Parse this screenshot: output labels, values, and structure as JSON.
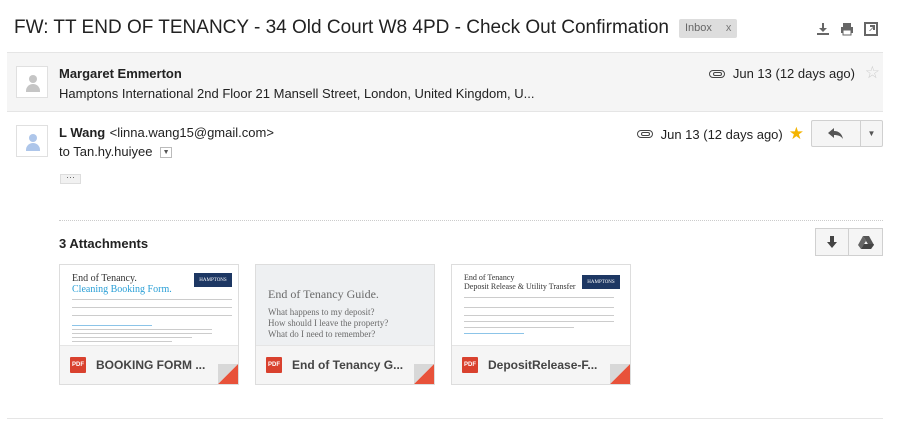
{
  "subject": "FW: TT END OF TENANCY - 34 Old Court W8 4PD - Check Out Confirmation",
  "label": {
    "name": "Inbox",
    "remove": "x"
  },
  "toolbar_icons": [
    "download-icon",
    "print-icon",
    "new-window-icon"
  ],
  "message1": {
    "sender": "Margaret Emmerton",
    "snippet": "Hamptons International 2nd Floor 21 Mansell Street, London, United Kingdom, U...",
    "date": "Jun 13 (12 days ago)",
    "starred": false
  },
  "message2": {
    "sender": "L Wang",
    "email": "<linna.wang15@gmail.com>",
    "to_prefix": "to",
    "to": "Tan.hy.huiyee",
    "date": "Jun 13 (12 days ago)",
    "starred": true,
    "ellipsis": "···"
  },
  "attachments": {
    "title": "3 Attachments",
    "items": [
      {
        "type": "PDF",
        "name": "BOOKING FORM ...",
        "thumb_line1": "End of Tenancy.",
        "thumb_line2": "Cleaning Booking Form."
      },
      {
        "type": "PDF",
        "name": "End of Tenancy G...",
        "thumb_line1": "End of Tenancy Guide.",
        "thumb_line2": "What happens to my deposit?",
        "thumb_line3": "How should I leave the property?",
        "thumb_line4": "What do I need to remember?"
      },
      {
        "type": "PDF",
        "name": "DepositRelease-F...",
        "thumb_line1": "End of Tenancy",
        "thumb_line2": "Deposit Release & Utility Transfer"
      }
    ]
  },
  "colors": {
    "star_on": "#f4b400",
    "pdf": "#d9412e",
    "fold": "#e8523a",
    "link_blue": "#2a9fd6"
  }
}
